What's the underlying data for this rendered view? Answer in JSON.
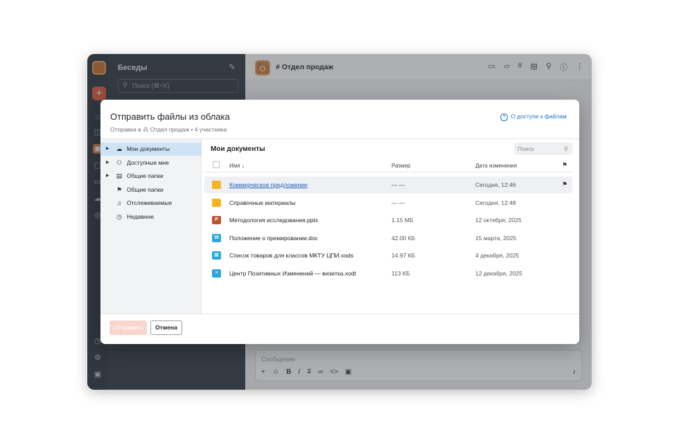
{
  "app": {
    "chats_title": "Беседы",
    "search_placeholder": "Поиск (⌘+K)",
    "channel_name": "Отдел продаж",
    "channel_initial": "О",
    "channel_hash": "#",
    "composer_placeholder": "Сообщение"
  },
  "dialog": {
    "title": "Отправить файлы из облака",
    "subtitle": "Отправка в ⁂ Отдел продаж • 4 участника",
    "access_link": "О доступе к файлам",
    "tree": [
      {
        "label": "Мои документы",
        "icon": "cloud-icon",
        "glyph": "☁",
        "expandable": true,
        "selected": true
      },
      {
        "label": "Доступные мне",
        "icon": "users-icon",
        "glyph": "⚇",
        "expandable": true,
        "selected": false
      },
      {
        "label": "Общие папки",
        "icon": "briefcase-icon",
        "glyph": "▤",
        "expandable": true,
        "selected": false
      },
      {
        "label": "Общие папки",
        "icon": "flag-icon",
        "glyph": "⚑",
        "expandable": false,
        "selected": false
      },
      {
        "label": "Отслеживаемые",
        "icon": "bell-icon",
        "glyph": "♫",
        "expandable": false,
        "selected": false
      },
      {
        "label": "Недавние",
        "icon": "clock-icon",
        "glyph": "◷",
        "expandable": false,
        "selected": false
      }
    ],
    "files_title": "Мои документы",
    "files_search_placeholder": "Поиск",
    "columns": {
      "name": "Имя",
      "size": "Размер",
      "date": "Дата изменения"
    },
    "files": [
      {
        "name": "Коммерческое предложение",
        "size": "— —",
        "date": "Сегодня, 12:46",
        "type": "folder",
        "highlighted": true,
        "flagged": true
      },
      {
        "name": "Справочные материалы",
        "size": "— —",
        "date": "Сегодня, 12:48",
        "type": "folder",
        "highlighted": false,
        "flagged": false
      },
      {
        "name": "Методология исследования.pptx",
        "size": "1.15 МБ",
        "date": "12 октября, 2025",
        "type": "pptx",
        "highlighted": false,
        "flagged": false
      },
      {
        "name": "Положение о премировании.doc",
        "size": "42.00 КБ",
        "date": "15 марта, 2025",
        "type": "doc",
        "highlighted": false,
        "flagged": false
      },
      {
        "name": "Список товаров для классов МКТУ ЦПИ.xods",
        "size": "14.97 КБ",
        "date": "4 декабря, 2025",
        "type": "xods",
        "highlighted": false,
        "flagged": false
      },
      {
        "name": "Центр Позитивных Изменений — визитка.xodt",
        "size": "113 КБ",
        "date": "12 декабря, 2025",
        "type": "xodt",
        "highlighted": false,
        "flagged": false
      }
    ],
    "send_label": "Отправить",
    "cancel_label": "Отмена"
  },
  "colors": {
    "accent": "#1a73c9",
    "folder": "#f5b41d",
    "pptx": "#b8532c",
    "doc": "#2aa7e0",
    "xods": "#2aa7e0",
    "xodt": "#2aa7e0"
  }
}
